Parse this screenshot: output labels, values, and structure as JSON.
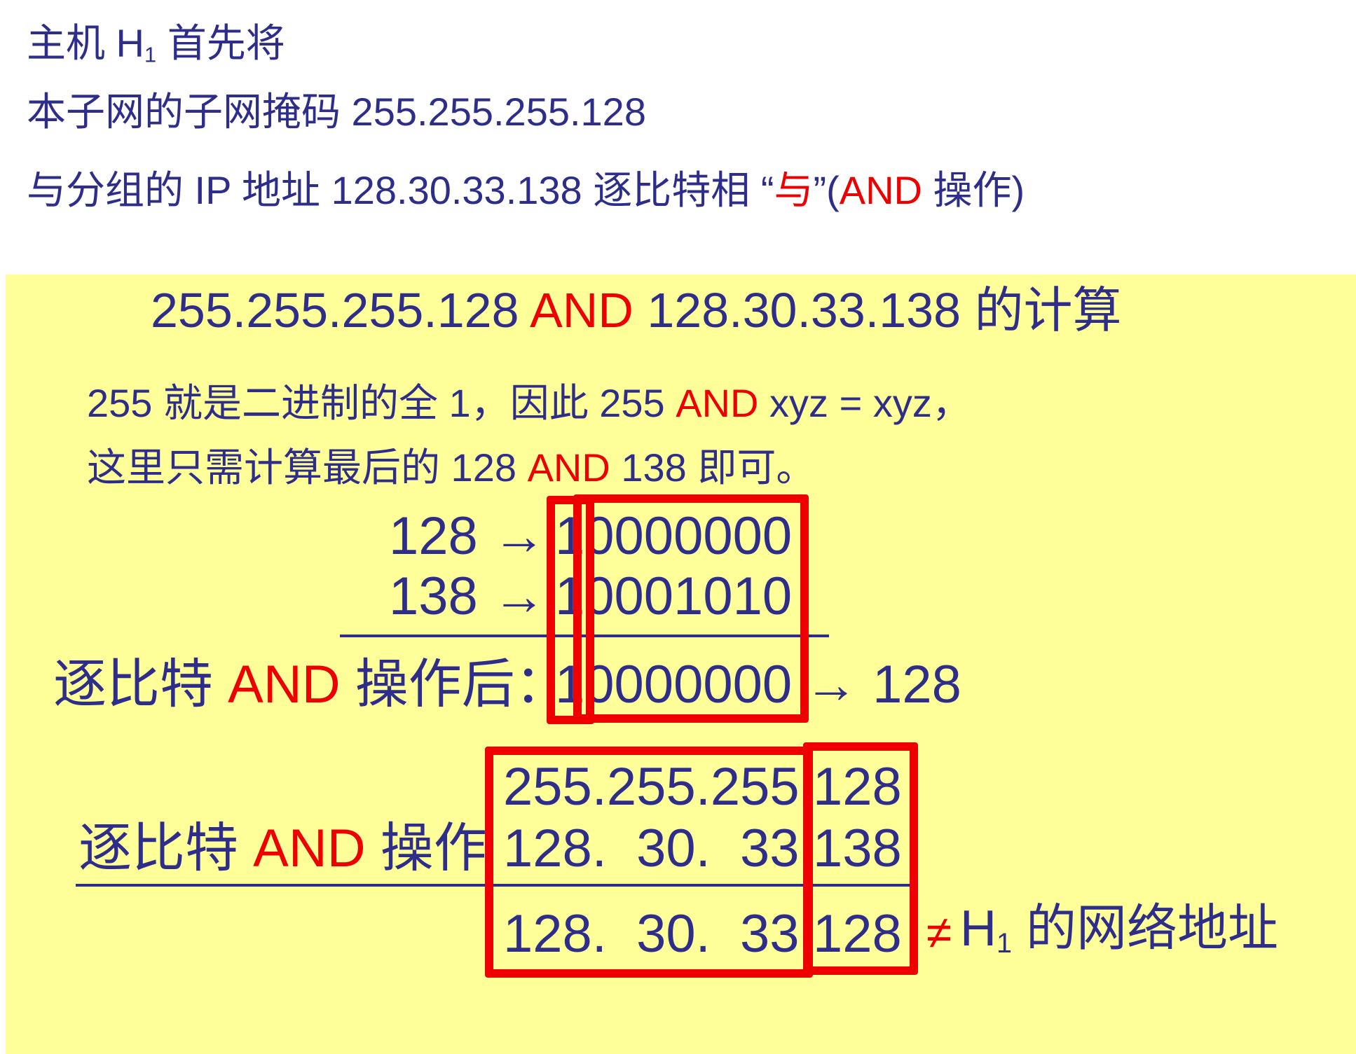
{
  "intro": {
    "line1_pre": "主机 H",
    "line1_sub": "1",
    "line1_post": " 首先将",
    "line2": "本子网的子网掩码 255.255.255.128",
    "line3_pre": "与分组的 IP 地址 128.30.33.138 逐比特相 “",
    "line3_red": "与",
    "line3_mid": "”(",
    "line3_red2": "AND",
    "line3_post": " 操作)"
  },
  "panel": {
    "title_a": "255.255.255.128 ",
    "title_and": "AND",
    "title_b": " 128.30.33.138 的计算",
    "note1_a": "255 就是二进制的全 1，因此 255 ",
    "note1_and": "AND",
    "note1_b": " xyz = xyz，",
    "note2_a": "这里只需计算最后的 128 ",
    "note2_and": "AND",
    "note2_b": " 138 即可。",
    "binary": {
      "row1_label": "128 →",
      "row1_bits": "10000000",
      "row2_label": "138 →",
      "row2_bits": "10001010",
      "result_label_a": "逐比特 ",
      "result_label_and": "AND",
      "result_label_b": " 操作后：",
      "result_bits": "10000000",
      "result_arrow": "→ 128"
    },
    "dotted": {
      "label_a": "逐比特 ",
      "label_and": "AND",
      "label_b": " 操作",
      "row1_prefix": "255.255.255.",
      "row1_last": "128",
      "row2_prefix": "128.  30.  33.",
      "row2_last": "138",
      "row3_prefix": "128.  30.  33.",
      "row3_last": "128",
      "neq": "≠",
      "tail_pre": " H",
      "tail_sub": "1",
      "tail_post": " 的网络地址"
    }
  }
}
